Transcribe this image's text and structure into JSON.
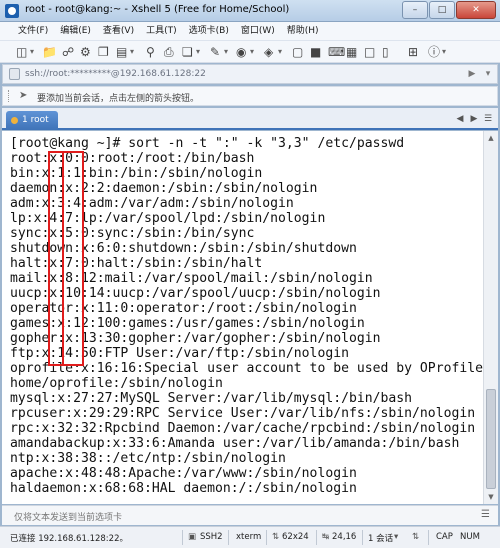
{
  "window": {
    "title": "root - root@kang:~ - Xshell 5 (Free for Home/School)"
  },
  "menu": {
    "items": [
      "文件(F)",
      "编辑(E)",
      "查看(V)",
      "工具(T)",
      "选项卡(B)",
      "窗口(W)",
      "帮助(H)"
    ]
  },
  "address": {
    "text": "ssh://root:*********@192.168.61.128:22"
  },
  "hint": {
    "text": "要添加当前会话，点击左侧的箭头按钮。"
  },
  "tabs": [
    {
      "label": "1 root"
    }
  ],
  "terminal": {
    "lines": [
      "[root@kang ~]# sort -n -t \":\" -k \"3,3\" /etc/passwd",
      "root:x:0:0:root:/root:/bin/bash",
      "bin:x:1:1:bin:/bin:/sbin/nologin",
      "daemon:x:2:2:daemon:/sbin:/sbin/nologin",
      "adm:x:3:4:adm:/var/adm:/sbin/nologin",
      "lp:x:4:7:lp:/var/spool/lpd:/sbin/nologin",
      "sync:x:5:0:sync:/sbin:/bin/sync",
      "shutdown:x:6:0:shutdown:/sbin:/sbin/shutdown",
      "halt:x:7:0:halt:/sbin:/sbin/halt",
      "mail:x:8:12:mail:/var/spool/mail:/sbin/nologin",
      "uucp:x:10:14:uucp:/var/spool/uucp:/sbin/nologin",
      "operator:x:11:0:operator:/root:/sbin/nologin",
      "games:x:12:100:games:/usr/games:/sbin/nologin",
      "gopher:x:13:30:gopher:/var/gopher:/sbin/nologin",
      "ftp:x:14:50:FTP User:/var/ftp:/sbin/nologin",
      "oprofile:x:16:16:Special user account to be used by OProfile:/",
      "home/oprofile:/sbin/nologin",
      "mysql:x:27:27:MySQL Server:/var/lib/mysql:/bin/bash",
      "rpcuser:x:29:29:RPC Service User:/var/lib/nfs:/sbin/nologin",
      "rpc:x:32:32:Rpcbind Daemon:/var/cache/rpcbind:/sbin/nologin",
      "amandabackup:x:33:6:Amanda user:/var/lib/amanda:/bin/bash",
      "ntp:x:38:38::/etc/ntp:/sbin/nologin",
      "apache:x:48:48:Apache:/var/www:/sbin/nologin",
      "haldaemon:x:68:68:HAL daemon:/:/sbin/nologin"
    ]
  },
  "input_bar": {
    "placeholder": "仅将文本发送到当前选项卡"
  },
  "status": {
    "connection": "已连接 192.168.61.128:22。",
    "protocol": "SSH2",
    "term": "xterm",
    "size": "62x24",
    "cursor": "24,16",
    "sessions": "1 会话",
    "caps": "CAP",
    "num": "NUM"
  },
  "colors": {
    "highlight": "#e01c1c",
    "tab_active": "#3f73b8"
  }
}
